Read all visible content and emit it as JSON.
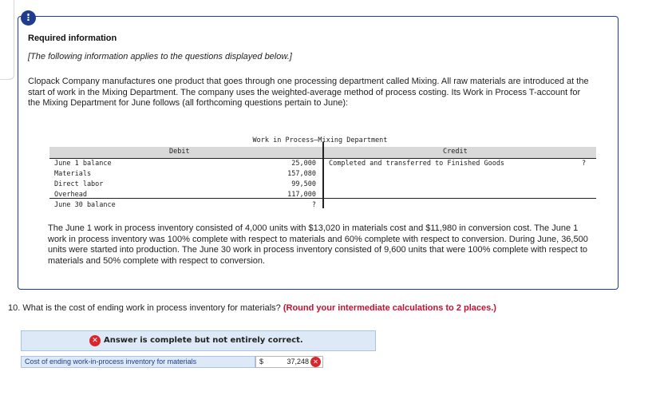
{
  "alert_icon": "!",
  "required_title": "Required information",
  "required_subtitle": "[The following information applies to the questions displayed below.]",
  "intro_text": "Clopack Company manufactures one product that goes through one processing department called Mixing. All raw materials are introduced at the start of work in the Mixing Department. The company uses the weighted-average method of process costing. Its Work in Process T-account for the Mixing Department for June follows (all forthcoming questions pertain to June):",
  "t_account": {
    "title": "Work in Process—Mixing Department",
    "debit_header": "Debit",
    "credit_header": "Credit",
    "debit_rows": [
      {
        "label": "June 1 balance",
        "value": "25,000"
      },
      {
        "label": "Materials",
        "value": "157,080"
      },
      {
        "label": "Direct labor",
        "value": "99,500"
      },
      {
        "label": "Overhead",
        "value": "117,000"
      }
    ],
    "ending_label": "June 30 balance",
    "ending_value": "?",
    "credit_label": "Completed and transferred to Finished Goods",
    "credit_value": "?"
  },
  "body_text": "The June 1 work in process inventory consisted of 4,000 units with $13,020 in materials cost and $11,980 in conversion cost. The June 1 work in process inventory was 100% complete with respect to materials and 60% complete with respect to conversion. During June, 36,500 units were started into production. The June 30 work in process inventory consisted of 9,600 units that were 100% complete with respect to materials and 50% complete with respect to conversion.",
  "question": {
    "text": "10. What is the cost of ending work in process inventory for materials?",
    "emphasis": "(Round your intermediate calculations to 2 places.)"
  },
  "answer_banner": {
    "icon": "x-circle-icon",
    "text": "Answer is complete but not entirely correct."
  },
  "answer_row": {
    "label": "Cost of ending work-in-process inventory for materials",
    "currency": "$",
    "value": "37,248",
    "status_icon": "x-circle-icon"
  },
  "colors": {
    "accent": "#1f3d8a",
    "error": "#d9262c",
    "emphasis": "#c8102e",
    "banner_bg": "#dde9f6"
  }
}
